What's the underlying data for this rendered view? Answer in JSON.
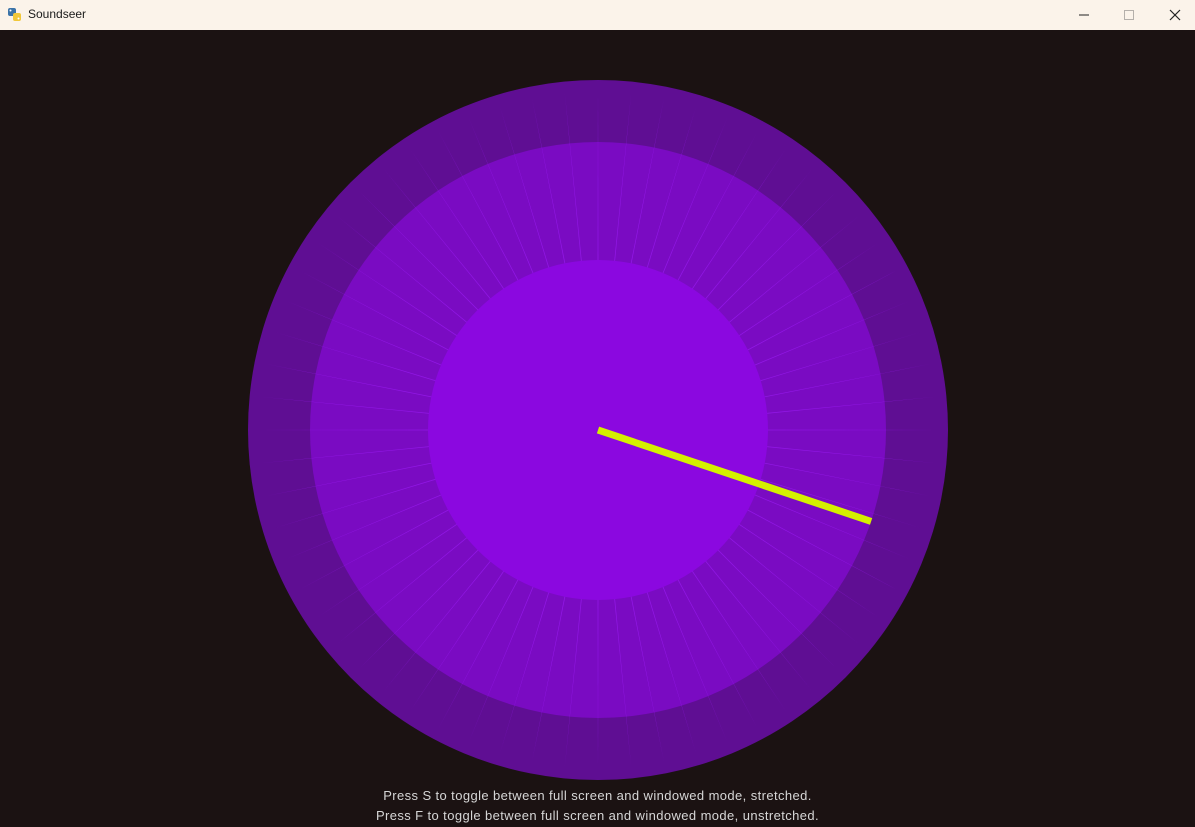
{
  "window": {
    "title": "Soundseer",
    "icon": "python-icon",
    "controls": {
      "minimize_icon": "minimize-icon",
      "maximize_icon": "maximize-icon",
      "close_icon": "close-icon"
    }
  },
  "visualizer": {
    "background_color": "#1b1212",
    "outer_ring_color": "#5f0e93",
    "mid_disc_color": "#7a0bc2",
    "core_color": "#8b08e0",
    "spoke_color": "#9a1cf0",
    "spoke_count": 64,
    "needle_color": "#d4f000",
    "needle_direction_deg": 18.5
  },
  "hints": {
    "line1": "Press S to toggle between full screen and windowed mode, stretched.",
    "line2": "Press F to toggle between full screen and windowed mode, unstretched."
  }
}
